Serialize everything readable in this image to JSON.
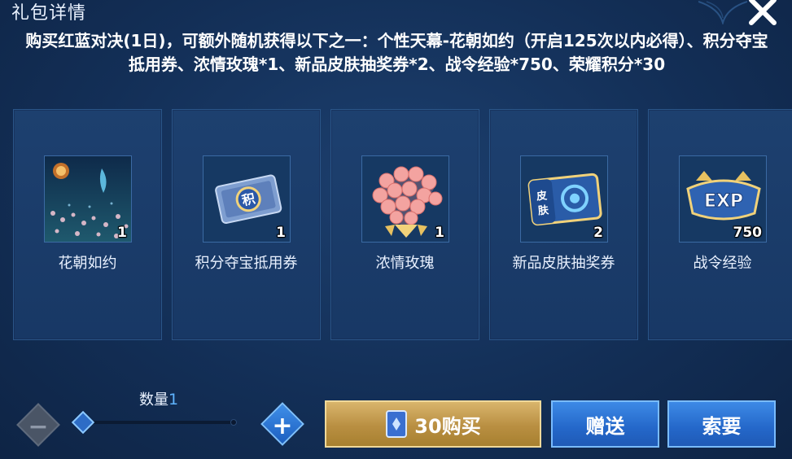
{
  "header": {
    "title": "礼包详情"
  },
  "description": "购买红蓝对决(1日)，可额外随机获得以下之一：个性天幕-花朝如约（开启125次以内必得）、积分夺宝抵用券、浓情玫瑰*1、新品皮肤抽奖券*2、战令经验*750、荣耀积分*30",
  "rewards": [
    {
      "label": "花朝如约",
      "qty": "1",
      "icon": "sky-curtain-icon"
    },
    {
      "label": "积分夺宝抵用券",
      "qty": "1",
      "icon": "points-voucher-icon"
    },
    {
      "label": "浓情玫瑰",
      "qty": "1",
      "icon": "rose-bouquet-icon"
    },
    {
      "label": "新品皮肤抽奖券",
      "qty": "2",
      "icon": "skin-ticket-icon"
    },
    {
      "label": "战令经验",
      "qty": "750",
      "icon": "exp-badge-icon"
    }
  ],
  "quantity": {
    "label": "数量",
    "value": "1",
    "minus": "−",
    "plus": "+"
  },
  "buttons": {
    "buy_price": "30购买",
    "gift": "赠送",
    "request": "索要"
  },
  "colors": {
    "background": "#132f57",
    "buy_gold": "#c49a4c",
    "action_blue": "#2f78d8",
    "quantity_accent": "#5fb4ff"
  }
}
